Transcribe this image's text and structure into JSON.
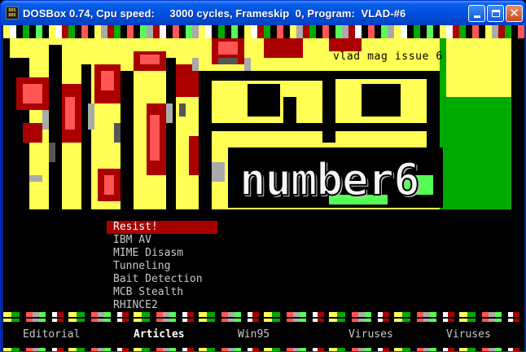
{
  "window": {
    "title": "DOSBox 0.74, Cpu speed:     3000 cycles, Frameskip  0, Program:  VLAD-#6",
    "icon_label_top": "DOS",
    "icon_label_bottom": "BOX",
    "controls": [
      "minimize-icon",
      "maximize-icon",
      "close-icon"
    ],
    "close_glyph": "✕"
  },
  "banner": {
    "issue": "vlad mag issue 6",
    "number_word": "number",
    "number_digit": "6"
  },
  "menu": {
    "items": [
      {
        "label": "Resist!",
        "selected": true
      },
      {
        "label": "IBM AV"
      },
      {
        "label": "MIME Disasm"
      },
      {
        "label": "Tunneling"
      },
      {
        "label": "Bait Detection"
      },
      {
        "label": "MCB Stealth"
      },
      {
        "label": "RHINCE2"
      }
    ]
  },
  "nav": {
    "items": [
      {
        "label": "Editorial"
      },
      {
        "label": "Articles",
        "active": true
      },
      {
        "label": "Win95"
      },
      {
        "label": "Viruses"
      },
      {
        "label": "Viruses"
      }
    ]
  },
  "colors": {
    "titlebar": "#0054e3",
    "selected_item": "#a80000",
    "banner_yellow": "#ffff55",
    "banner_red": "#aa0000",
    "banner_green": "#00aa00"
  }
}
